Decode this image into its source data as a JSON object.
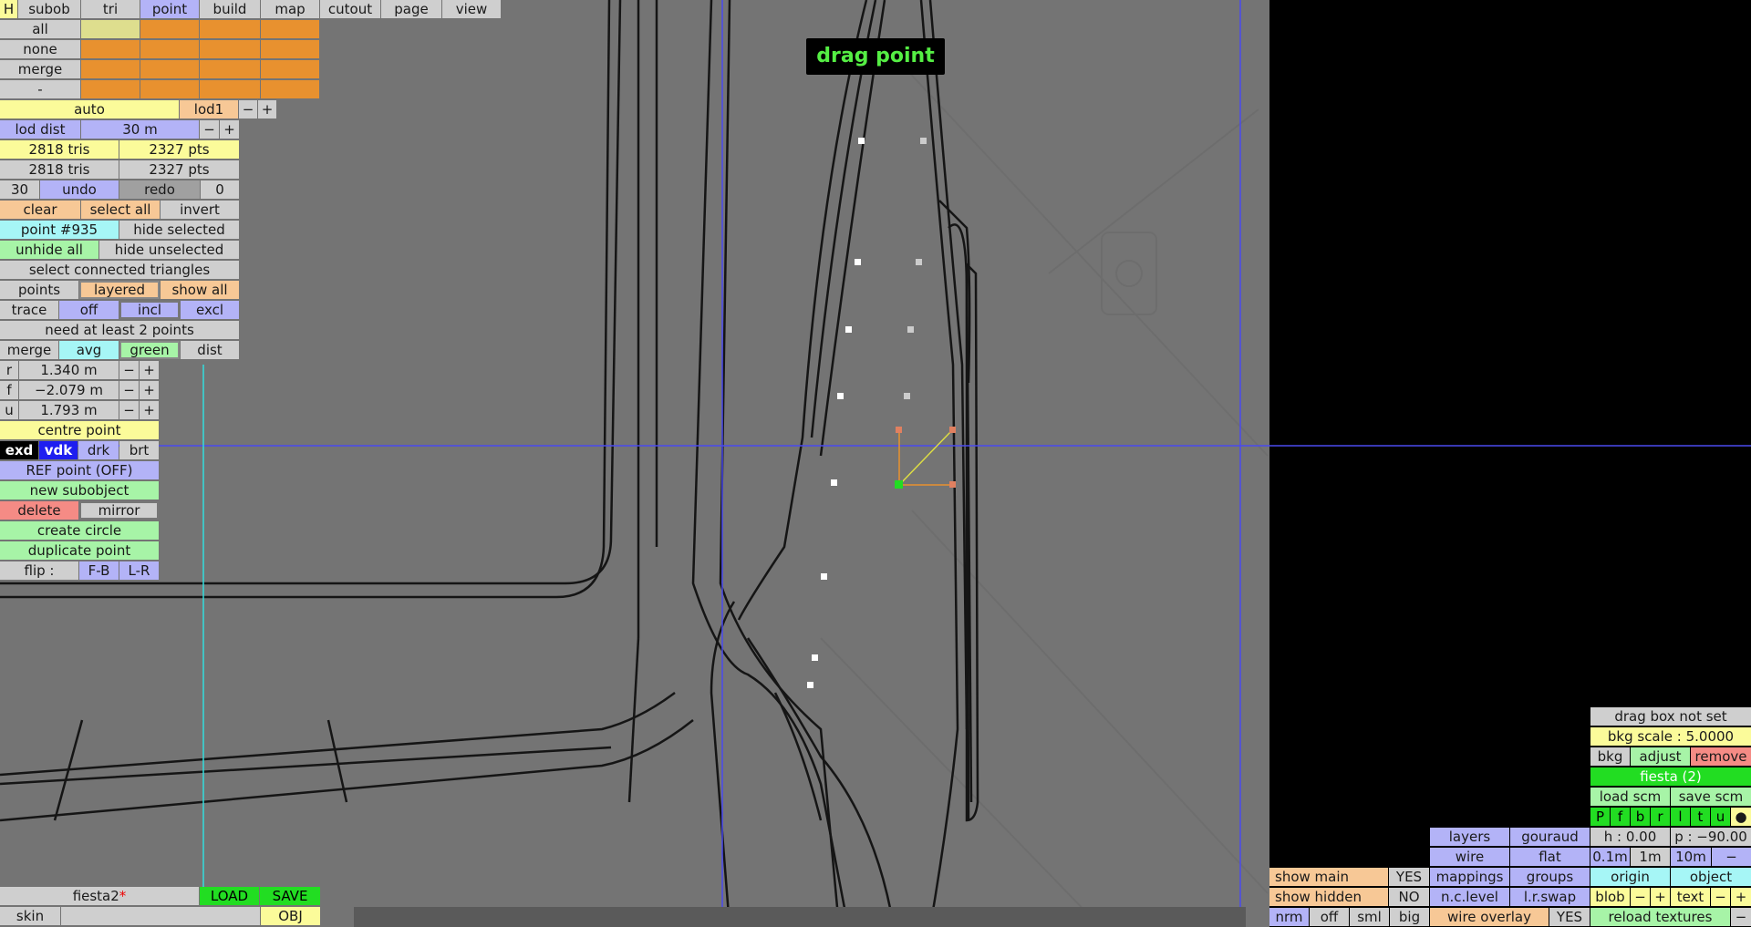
{
  "overlay": {
    "mode_label": "drag point"
  },
  "menu": {
    "h_label": "H",
    "tabs": [
      "subob",
      "tri",
      "point",
      "build",
      "map",
      "cutout",
      "page",
      "view"
    ],
    "active_tab": "point"
  },
  "select_rows": [
    "all",
    "none",
    "merge",
    "-"
  ],
  "lod": {
    "auto": "auto",
    "lod1": "lod1",
    "minus": "−",
    "plus": "+",
    "dist_label": "lod dist",
    "dist_value": "30 m"
  },
  "stats": {
    "tris1": "2818 tris",
    "pts1": "2327 pts",
    "tris2": "2818 tris",
    "pts2": "2327 pts"
  },
  "history": {
    "undo_count": "30",
    "undo": "undo",
    "redo": "redo",
    "redo_count": "0"
  },
  "selection": {
    "clear": "clear",
    "select_all": "select all",
    "invert": "invert"
  },
  "point": {
    "id": "point #935",
    "hide_selected": "hide selected",
    "unhide_all": "unhide all",
    "hide_unselected": "hide unselected",
    "select_connected": "select connected triangles"
  },
  "display": {
    "points": "points",
    "layered": "layered",
    "show_all": "show all"
  },
  "trace": {
    "label": "trace",
    "off": "off",
    "incl": "incl",
    "excl": "excl"
  },
  "status_message": "need at least 2 points",
  "merge_opts": {
    "merge": "merge",
    "avg": "avg",
    "green": "green",
    "dist": "dist"
  },
  "coords": [
    {
      "axis": "r",
      "value": "1.340 m"
    },
    {
      "axis": "f",
      "value": "−2.079 m"
    },
    {
      "axis": "u",
      "value": "1.793 m"
    }
  ],
  "actions": {
    "centre_point": "centre point",
    "shade": [
      "exd",
      "vdk",
      "drk",
      "brt"
    ],
    "ref_point": "REF point (OFF)",
    "new_subobject": "new subobject",
    "delete": "delete",
    "mirror": "mirror",
    "create_circle": "create circle",
    "duplicate_point": "duplicate point",
    "flip_label": "flip :",
    "flip_fb": "F-B",
    "flip_lr": "L-R"
  },
  "file": {
    "name": "fiesta2",
    "modified_mark": "*",
    "load": "LOAD",
    "save": "SAVE",
    "skin": "skin",
    "obj": "OBJ"
  },
  "bkg": {
    "drag_box": "drag box not set",
    "scale": "bkg scale : 5.0000",
    "bkg": "bkg",
    "adjust": "adjust",
    "remove": "remove",
    "name": "fiesta (2)",
    "load_scm": "load scm",
    "save_scm": "save scm",
    "views": [
      "P",
      "f",
      "b",
      "r",
      "l",
      "t",
      "u"
    ],
    "dot": "●"
  },
  "render": {
    "layers": "layers",
    "gouraud": "gouraud",
    "wire": "wire",
    "flat": "flat",
    "mappings": "mappings",
    "groups": "groups",
    "nc_level": "n.c.level",
    "lr_swap": "l.r.swap",
    "wire_overlay": "wire overlay",
    "wire_overlay_value": "YES"
  },
  "camera": {
    "h": "h : 0.00",
    "p": "p : −90.00",
    "steps": [
      "0.1m",
      "1m",
      "10m"
    ],
    "minus": "−",
    "origin": "origin",
    "object": "object",
    "blob": "blob",
    "text": "text",
    "minus2": "−",
    "plus2": "+",
    "reload": "reload textures"
  },
  "show": {
    "main": "show main",
    "main_value": "YES",
    "hidden": "show hidden",
    "hidden_value": "NO",
    "nrm": "nrm",
    "off": "off",
    "sml": "sml",
    "big": "big"
  }
}
